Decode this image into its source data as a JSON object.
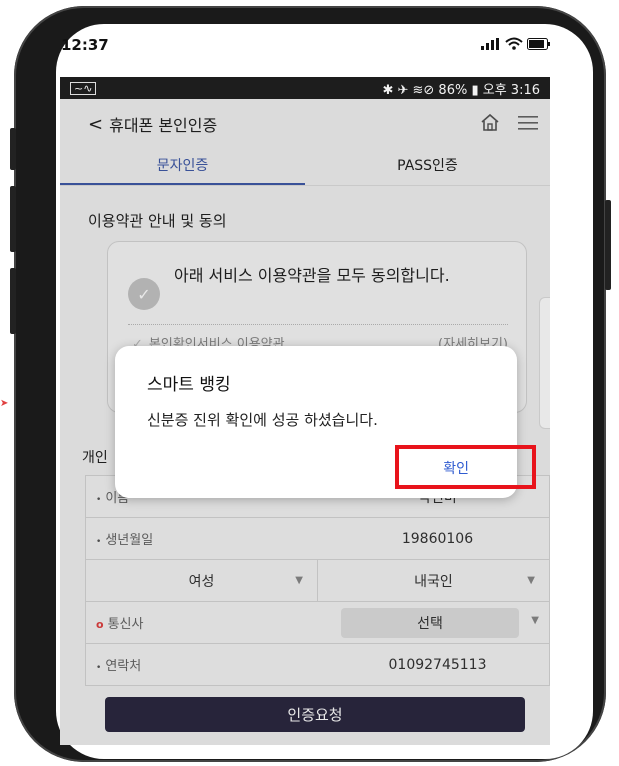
{
  "device": {
    "outer_time": "12:37",
    "android_status": {
      "left_icon": "activity-icon",
      "right_text": "✱ ✈ ≋⊘ 86% ▮ 오후 3:16"
    }
  },
  "header": {
    "title": "휴대폰 본인인증",
    "back_icon": "chevron-left-icon",
    "home_icon": "home-icon",
    "menu_icon": "hamburger-menu-icon"
  },
  "tabs": [
    {
      "label": "문자인증",
      "active": true
    },
    {
      "label": "PASS인증",
      "active": false
    }
  ],
  "terms": {
    "section_title": "이용약관 안내 및 동의",
    "agree_all": "아래 서비스 이용약관을 모두 동의합니다.",
    "items": [
      {
        "label": "본인확인서비스 이용약관",
        "detail": "(자세히보기)"
      }
    ]
  },
  "info": {
    "heading": "개인",
    "name_label": "이름",
    "name_value": "박선미",
    "birth_label": "생년월일",
    "birth_value": "19860106",
    "gender": "여성",
    "nationality": "내국인",
    "carrier_label": "통신사",
    "carrier_select": "선택",
    "phone_label": "연락처",
    "phone_value": "01092745113",
    "auth_button": "인증요청"
  },
  "dialog": {
    "title": "스마트 뱅킹",
    "message": "신분증 진위 확인에 성공 하셨습니다.",
    "confirm": "확인"
  },
  "colors": {
    "accent": "#3f5aa8",
    "button_dark": "#2b2840",
    "highlight": "#e8131b",
    "confirm_text": "#2f5bd0"
  }
}
